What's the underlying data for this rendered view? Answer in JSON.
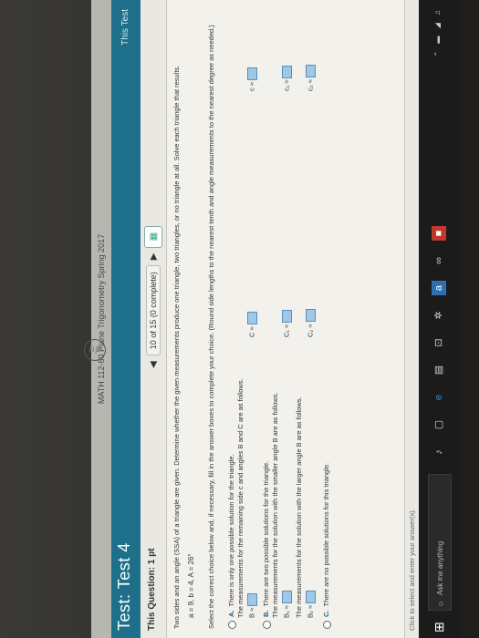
{
  "browser": {
    "tab_title": "MATH 112-80 Plane Trigonometry Spring 2017"
  },
  "header": {
    "title": "Test: Test 4",
    "right_text": "This Test"
  },
  "question": {
    "label": "This Question: 1 pt",
    "counter": "10 of 15 (0 complete)"
  },
  "problem": {
    "prompt": "Two sides and an angle (SSA) of a triangle are given. Determine whether the given measurements produce one triangle, two triangles, or no triangle at all. Solve each triangle that results.",
    "given": "a = 9,   b = 4,   A = 26°",
    "instruction": "Select the correct choice below and, if necessary, fill in the answer boxes to complete your choice. (Round side lengths to the nearest tenth and angle measurements to the nearest degree as needed.)",
    "choices": [
      {
        "letter": "A.",
        "text": "There is only one possible solution for the triangle."
      },
      {
        "letter": "B.",
        "text": "There are two possible solutions for the triangle."
      },
      {
        "letter": "C.",
        "text": "There are no possible solutions for this triangle."
      }
    ],
    "a_sub": "The measurements for the remaining side c and angles B and C are as follows.",
    "a_b": "B ≈",
    "a_c": "C ≈",
    "a_side_c": "c ≈",
    "b_sub1": "The measurements for the solution with the smaller angle B are as follows.",
    "b_b1": "B₁ ≈",
    "b_c1": "C₁ ≈",
    "b_side_c1": "c₁ ≈",
    "b_sub2": "The measurements for the solution with the larger angle B are as follows.",
    "b_b2": "B₂ ≈",
    "b_c2": "C₂ ≈",
    "b_side_c2": "c₂ ≈"
  },
  "status": {
    "text": "Click to select and enter your answer(s)."
  },
  "taskbar": {
    "search_placeholder": "Ask me anything"
  },
  "logo": {
    "text": "hp"
  }
}
